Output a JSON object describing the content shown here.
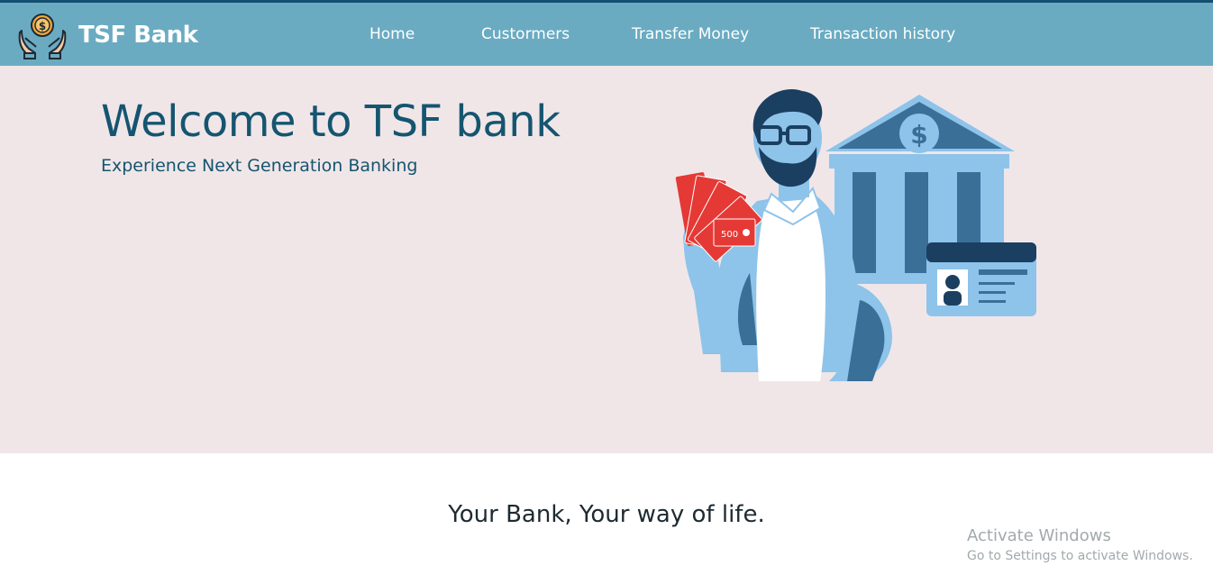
{
  "navbar": {
    "brand_name": "TSF Bank",
    "logo_icon": "hands-holding-coin-icon",
    "links": [
      {
        "label": "Home"
      },
      {
        "label": "Custormers"
      },
      {
        "label": "Transfer Money"
      },
      {
        "label": "Transaction history"
      }
    ]
  },
  "hero": {
    "title": "Welcome to TSF bank",
    "subtitle": "Experience Next Generation Banking",
    "illustration": {
      "description_icon": "banker-with-cash-and-bank-illustration",
      "note_label": "500",
      "currency_symbol": "$"
    }
  },
  "tagline": "Your Bank, Your way of life.",
  "watermark": {
    "title": "Activate Windows",
    "subtitle": "Go to Settings to activate Windows."
  },
  "colors": {
    "navbar": "#6aabc2",
    "navbar_border": "#144f6f",
    "hero_bg": "#f0e6e8",
    "heading": "#155570"
  }
}
